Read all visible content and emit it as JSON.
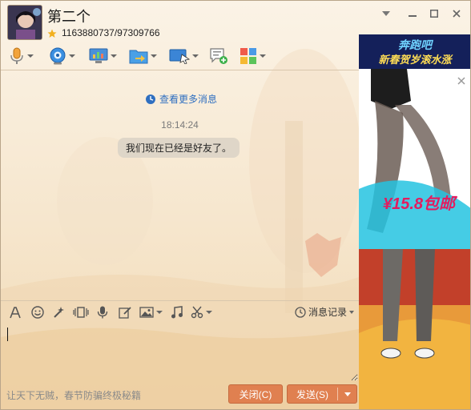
{
  "window": {
    "contact_name": "第二个",
    "contact_ids": "1163880737/97309766"
  },
  "toolbar": {
    "items": [
      {
        "icon": "microphone-icon"
      },
      {
        "icon": "webcam-icon"
      },
      {
        "icon": "remote-desktop-icon"
      },
      {
        "icon": "send-file-icon"
      },
      {
        "icon": "screen-share-icon"
      },
      {
        "icon": "message-add-icon"
      },
      {
        "icon": "apps-grid-icon"
      }
    ]
  },
  "chat": {
    "more_messages": "查看更多消息",
    "time": "18:14:24",
    "system_message": "我们现在已经是好友了。"
  },
  "input_toolbar": {
    "history_label": "消息记录"
  },
  "footer": {
    "tip": "让天下无贼，春节防骗终极秘籍",
    "close_label": "关闭(C)",
    "send_label": "发送(S)"
  },
  "ad": {
    "banner_text": "奔跑吧 新春贺岁滚水涨",
    "price_text": "¥15.8包邮"
  },
  "colors": {
    "accent_button": "#e08050",
    "link": "#2f6fc0"
  }
}
